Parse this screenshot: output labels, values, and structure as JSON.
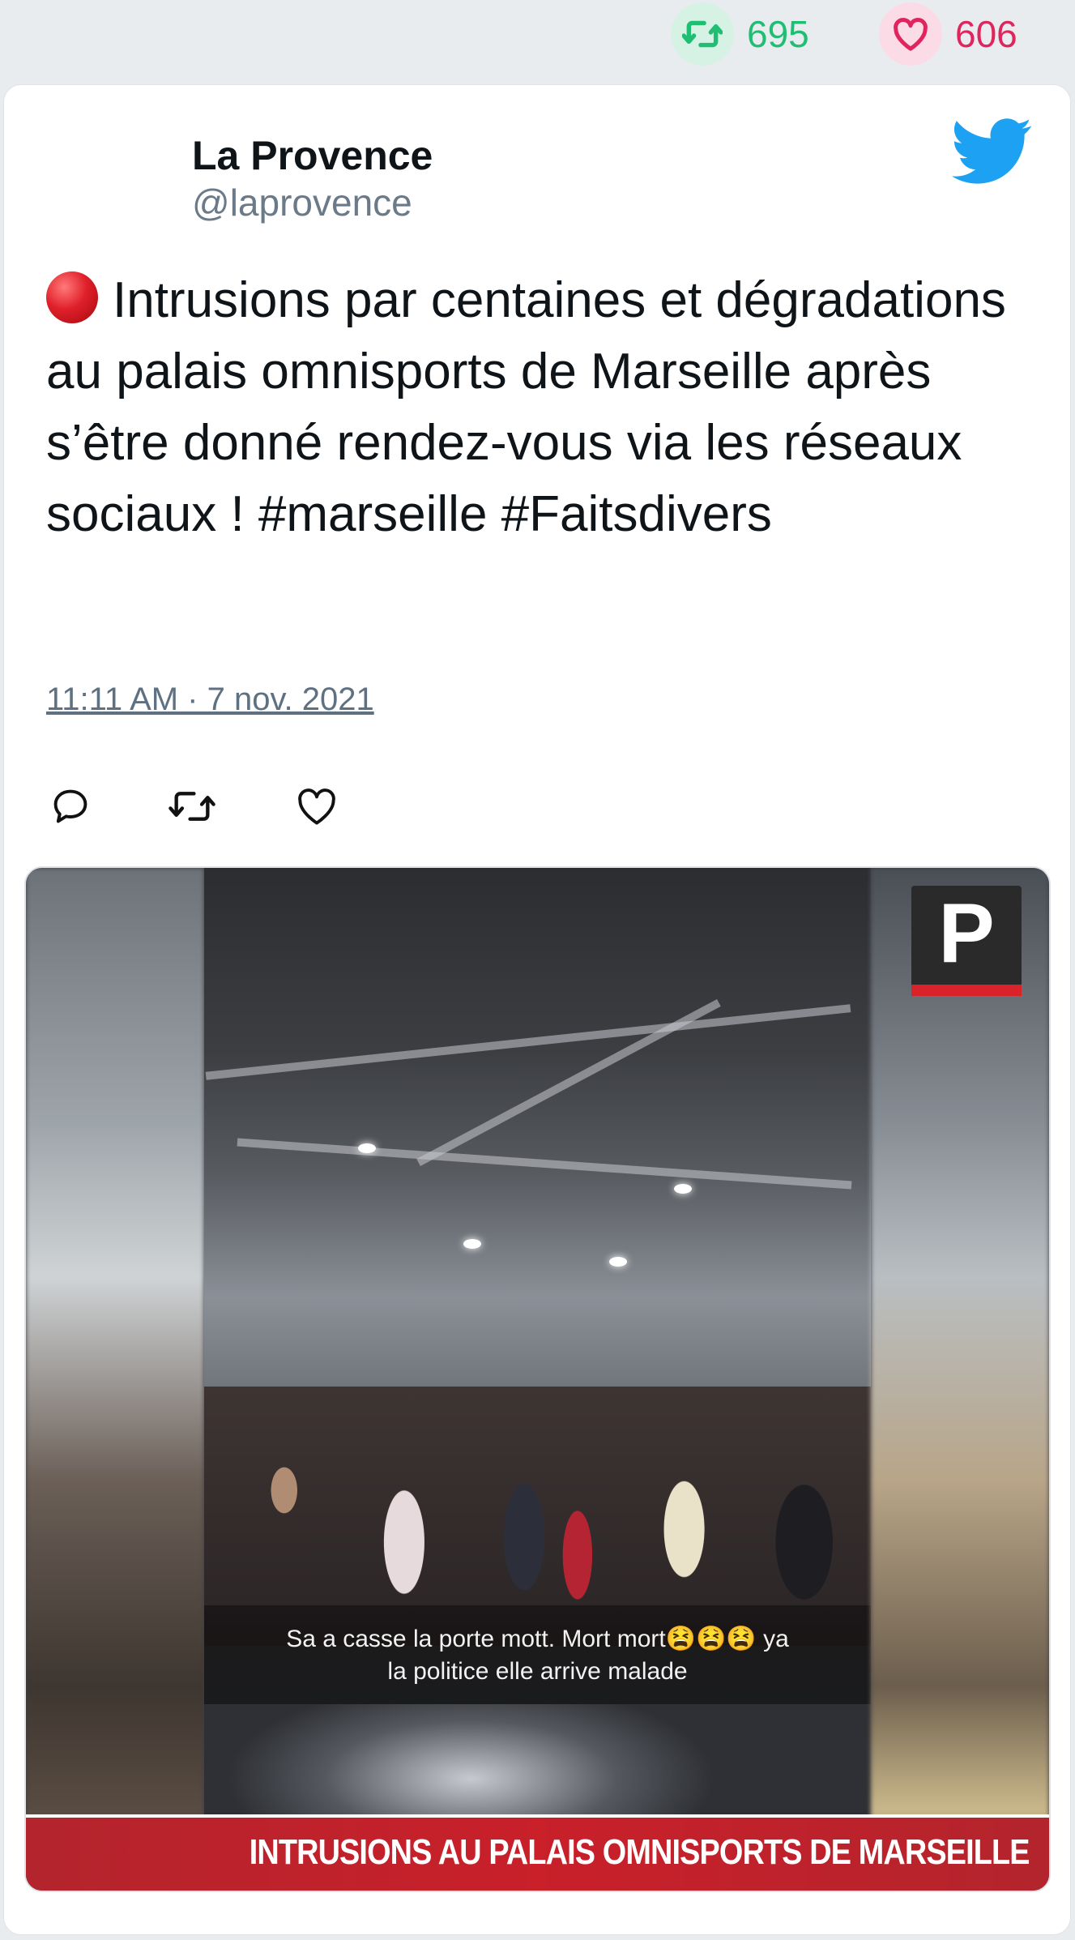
{
  "stats": {
    "retweets": "695",
    "likes": "606"
  },
  "user": {
    "name": "La Provence",
    "handle": "@laprovence"
  },
  "tweet": {
    "text": "Intrusions par centaines et dégradations au palais omnisports de Marseille après s’être donné rendez-vous via les réseaux sociaux ! #marseille #Faitsdivers",
    "timestamp": "11:11 AM · 7 nov. 2021"
  },
  "media": {
    "logo_letter": "P",
    "caption_line1": "Sa a casse la porte mott. Mort mort😫😫😫 ya",
    "caption_line2": "la politice elle arrive malade",
    "banner": "INTRUSIONS AU PALAIS OMNISPORTS DE MARSEILLE"
  },
  "icons": {
    "stat_retweet": "retweet-icon",
    "stat_like": "heart-icon",
    "brand": "twitter-bird-icon",
    "status": "red-circle-emoji",
    "reply": "reply-icon",
    "retweet": "retweet-icon",
    "like": "heart-icon"
  },
  "colors": {
    "retweet": "#1fbf73",
    "like": "#e0245e",
    "twitter": "#1da1f2"
  }
}
